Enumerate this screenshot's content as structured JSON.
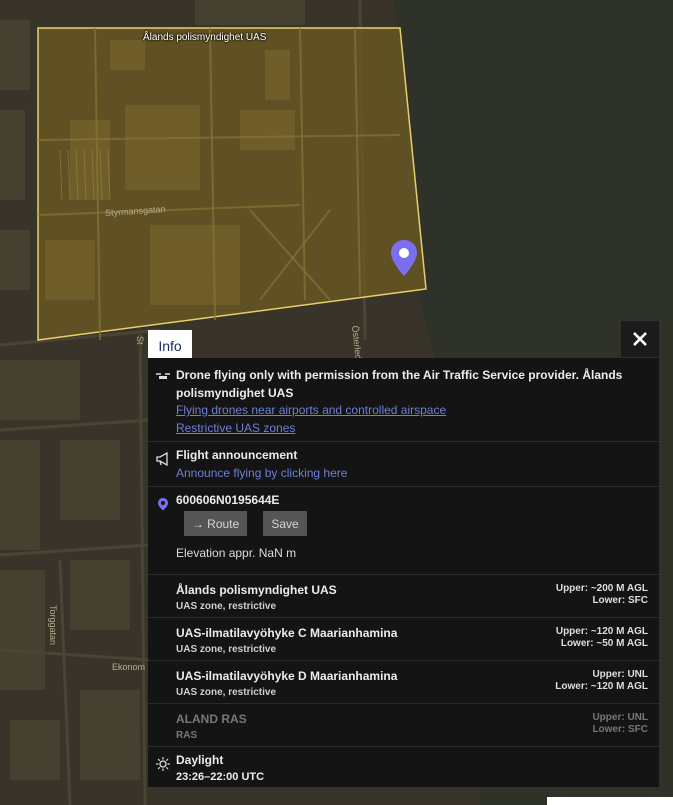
{
  "map": {
    "zone_label": "Ålands polismyndighet UAS",
    "streets": [
      "Styrmansgatan",
      "Österleden",
      "Torggatan",
      "Ekonom",
      "St"
    ]
  },
  "tabs": {
    "info_label": "Info"
  },
  "panel": {
    "notice": {
      "text": "Drone flying only with permission from the Air Traffic Service provider. Ålands polismyndighet UAS",
      "link1": "Flying drones near airports and controlled airspace",
      "link2": "Restrictive UAS zones"
    },
    "announcement": {
      "title": "Flight announcement",
      "link": "Announce flying by clicking here"
    },
    "location": {
      "code": "600606N0195644E",
      "route_label": "→ Route",
      "save_label": "Save",
      "elevation": "Elevation appr. NaN m"
    },
    "zones": [
      {
        "name": "Ålands polismyndighet UAS",
        "type": "UAS zone, restrictive",
        "upper": "Upper: ~200 M AGL",
        "lower": "Lower: SFC"
      },
      {
        "name": "UAS-ilmatilavyöhyke C Maarianhamina",
        "type": "UAS zone, restrictive",
        "upper": "Upper: ~120 M AGL",
        "lower": "Lower: ~50 M AGL"
      },
      {
        "name": "UAS-ilmatilavyöhyke D Maarianhamina",
        "type": "UAS zone, restrictive",
        "upper": "Upper: UNL",
        "lower": "Lower: ~120 M AGL"
      },
      {
        "name": "ALAND RAS",
        "type": "RAS",
        "upper": "Upper: UNL",
        "lower": "Lower: SFC"
      }
    ],
    "daylight": {
      "title": "Daylight",
      "time": "23:26–22:00 UTC"
    }
  },
  "colors": {
    "zone_fill": "#6b5a22",
    "zone_stroke": "#e8cf6a",
    "marker": "#7b6ef0",
    "link": "#6b80d8"
  },
  "icons": [
    "drone-icon",
    "megaphone-icon",
    "location-pin-icon",
    "sun-icon",
    "close-icon"
  ]
}
